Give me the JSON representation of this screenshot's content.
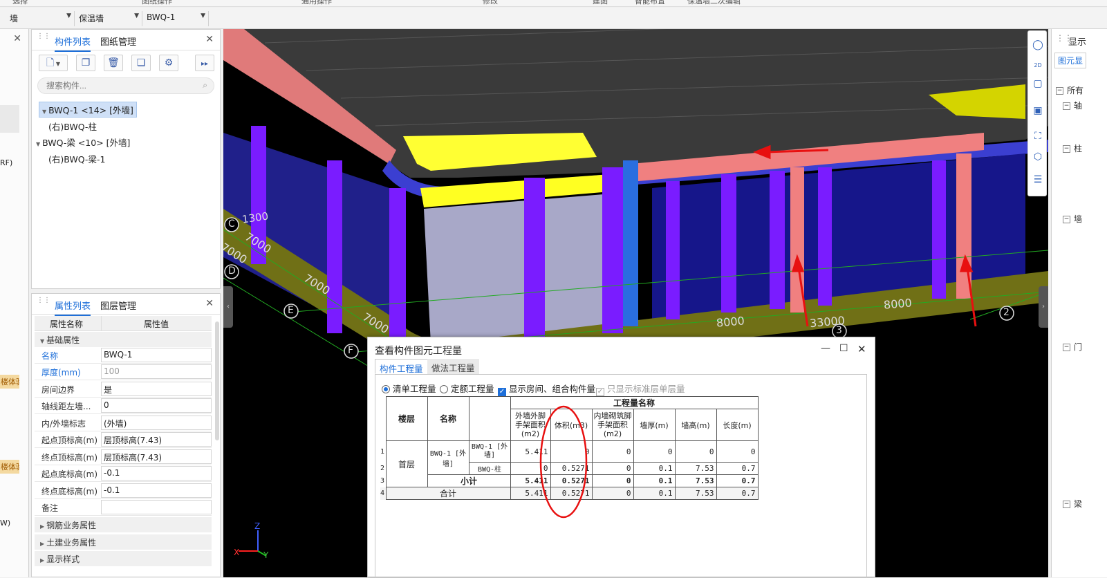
{
  "top_strip": [
    "选择",
    "图纸操作",
    "通用操作",
    "修改",
    "建图",
    "智能布置",
    "保温墙二次编辑"
  ],
  "toolbar": {
    "combos": [
      "墙",
      "保温墙",
      "BWQ-1"
    ]
  },
  "left_strip": {
    "fragments": [
      "RF)",
      "W)"
    ],
    "badges": [
      "楼体验",
      "楼体验"
    ]
  },
  "component_list": {
    "tabs": [
      "构件列表",
      "图纸管理"
    ],
    "search_placeholder": "搜索构件...",
    "tree": [
      {
        "label": "BWQ-1 <14> [外墙]",
        "selected": true
      },
      {
        "label": "(右)BWQ-柱"
      },
      {
        "label": "BWQ-梁 <10> [外墙]"
      },
      {
        "label": "(右)BWQ-梁-1"
      }
    ]
  },
  "property_list": {
    "tabs": [
      "属性列表",
      "图层管理"
    ],
    "header": {
      "name": "属性名称",
      "value": "属性值"
    },
    "groups": [
      "基础属性",
      "钢筋业务属性",
      "土建业务属性",
      "显示样式"
    ],
    "rows": [
      {
        "name": "名称",
        "value": "BWQ-1"
      },
      {
        "name": "厚度(mm)",
        "value": "100"
      },
      {
        "name": "房间边界",
        "value": "是"
      },
      {
        "name": "轴线距左墙...",
        "value": "0"
      },
      {
        "name": "内/外墙标志",
        "value": "(外墙)"
      },
      {
        "name": "起点顶标高(m)",
        "value": "层顶标高(7.43)"
      },
      {
        "name": "终点顶标高(m)",
        "value": "层顶标高(7.43)"
      },
      {
        "name": "起点底标高(m)",
        "value": "-0.1"
      },
      {
        "name": "终点底标高(m)",
        "value": "-0.1"
      },
      {
        "name": "备注",
        "value": ""
      }
    ]
  },
  "viewport": {
    "axis_labels": [
      "C",
      "D",
      "E",
      "F",
      "2",
      "3"
    ],
    "dimensions": [
      "1300",
      "7000",
      "7000",
      "7000",
      "7000",
      "8000",
      "8000",
      "33000"
    ],
    "gizmo": [
      "X",
      "Y",
      "Z"
    ]
  },
  "right_panel": {
    "title": "显示",
    "tab": "图元显",
    "items": [
      "所有",
      "轴",
      "柱",
      "墙",
      "门",
      "梁"
    ]
  },
  "dialog": {
    "title": "查看构件图元工程量",
    "tabs": [
      "构件工程量",
      "做法工程量"
    ],
    "options": [
      "清单工程量",
      "定额工程量",
      "显示房间、组合构件量",
      "只显示标准层单层量"
    ],
    "table": {
      "group_header": "工程量名称",
      "col_floor": "楼层",
      "col_name": "名称",
      "columns": [
        "外墙外脚手架面积(m2)",
        "体积(m3)",
        "内墙砌筑脚手架面积(m2)",
        "墙厚(m)",
        "墙高(m)",
        "长度(m)"
      ],
      "row_numbers": [
        "1",
        "2",
        "3",
        "4"
      ],
      "floor": "首层",
      "component": "BWQ-1 [外墙]",
      "rows": [
        {
          "sub": "BWQ-1 [外墙]",
          "values": [
            "5.411",
            "0",
            "0",
            "0",
            "0",
            "0"
          ]
        },
        {
          "sub": "BWQ-柱",
          "values": [
            "0",
            "0.5271",
            "0",
            "0.1",
            "7.53",
            "0.7"
          ]
        }
      ],
      "subtotal": {
        "label": "小计",
        "values": [
          "5.411",
          "0.5271",
          "0",
          "0.1",
          "7.53",
          "0.7"
        ]
      },
      "total": {
        "label": "合计",
        "values": [
          "5.411",
          "0.5271",
          "0",
          "0.1",
          "7.53",
          "0.7"
        ]
      }
    }
  },
  "colors": {
    "accent": "#1e6fd9",
    "annotation_red": "#e81010"
  }
}
